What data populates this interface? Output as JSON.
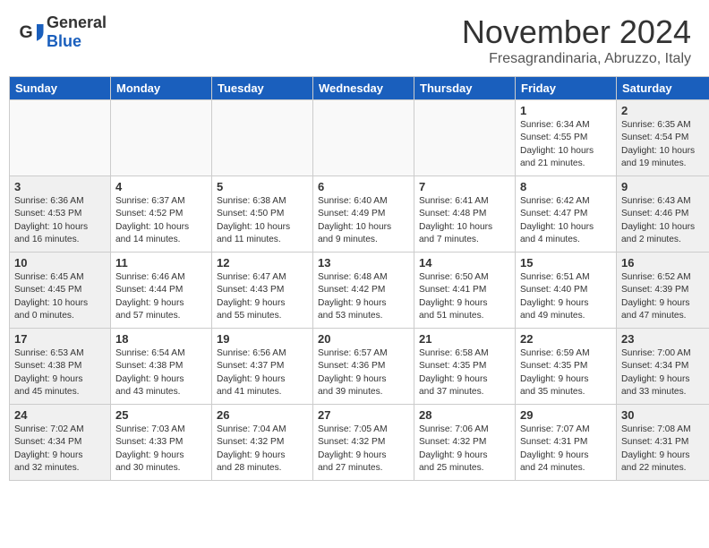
{
  "logo": {
    "general": "General",
    "blue": "Blue"
  },
  "title": "November 2024",
  "location": "Fresagrandinaria, Abruzzo, Italy",
  "days": [
    "Sunday",
    "Monday",
    "Tuesday",
    "Wednesday",
    "Thursday",
    "Friday",
    "Saturday"
  ],
  "weeks": [
    [
      {
        "day": "",
        "info": ""
      },
      {
        "day": "",
        "info": ""
      },
      {
        "day": "",
        "info": ""
      },
      {
        "day": "",
        "info": ""
      },
      {
        "day": "",
        "info": ""
      },
      {
        "day": "1",
        "info": "Sunrise: 6:34 AM\nSunset: 4:55 PM\nDaylight: 10 hours\nand 21 minutes."
      },
      {
        "day": "2",
        "info": "Sunrise: 6:35 AM\nSunset: 4:54 PM\nDaylight: 10 hours\nand 19 minutes."
      }
    ],
    [
      {
        "day": "3",
        "info": "Sunrise: 6:36 AM\nSunset: 4:53 PM\nDaylight: 10 hours\nand 16 minutes."
      },
      {
        "day": "4",
        "info": "Sunrise: 6:37 AM\nSunset: 4:52 PM\nDaylight: 10 hours\nand 14 minutes."
      },
      {
        "day": "5",
        "info": "Sunrise: 6:38 AM\nSunset: 4:50 PM\nDaylight: 10 hours\nand 11 minutes."
      },
      {
        "day": "6",
        "info": "Sunrise: 6:40 AM\nSunset: 4:49 PM\nDaylight: 10 hours\nand 9 minutes."
      },
      {
        "day": "7",
        "info": "Sunrise: 6:41 AM\nSunset: 4:48 PM\nDaylight: 10 hours\nand 7 minutes."
      },
      {
        "day": "8",
        "info": "Sunrise: 6:42 AM\nSunset: 4:47 PM\nDaylight: 10 hours\nand 4 minutes."
      },
      {
        "day": "9",
        "info": "Sunrise: 6:43 AM\nSunset: 4:46 PM\nDaylight: 10 hours\nand 2 minutes."
      }
    ],
    [
      {
        "day": "10",
        "info": "Sunrise: 6:45 AM\nSunset: 4:45 PM\nDaylight: 10 hours\nand 0 minutes."
      },
      {
        "day": "11",
        "info": "Sunrise: 6:46 AM\nSunset: 4:44 PM\nDaylight: 9 hours\nand 57 minutes."
      },
      {
        "day": "12",
        "info": "Sunrise: 6:47 AM\nSunset: 4:43 PM\nDaylight: 9 hours\nand 55 minutes."
      },
      {
        "day": "13",
        "info": "Sunrise: 6:48 AM\nSunset: 4:42 PM\nDaylight: 9 hours\nand 53 minutes."
      },
      {
        "day": "14",
        "info": "Sunrise: 6:50 AM\nSunset: 4:41 PM\nDaylight: 9 hours\nand 51 minutes."
      },
      {
        "day": "15",
        "info": "Sunrise: 6:51 AM\nSunset: 4:40 PM\nDaylight: 9 hours\nand 49 minutes."
      },
      {
        "day": "16",
        "info": "Sunrise: 6:52 AM\nSunset: 4:39 PM\nDaylight: 9 hours\nand 47 minutes."
      }
    ],
    [
      {
        "day": "17",
        "info": "Sunrise: 6:53 AM\nSunset: 4:38 PM\nDaylight: 9 hours\nand 45 minutes."
      },
      {
        "day": "18",
        "info": "Sunrise: 6:54 AM\nSunset: 4:38 PM\nDaylight: 9 hours\nand 43 minutes."
      },
      {
        "day": "19",
        "info": "Sunrise: 6:56 AM\nSunset: 4:37 PM\nDaylight: 9 hours\nand 41 minutes."
      },
      {
        "day": "20",
        "info": "Sunrise: 6:57 AM\nSunset: 4:36 PM\nDaylight: 9 hours\nand 39 minutes."
      },
      {
        "day": "21",
        "info": "Sunrise: 6:58 AM\nSunset: 4:35 PM\nDaylight: 9 hours\nand 37 minutes."
      },
      {
        "day": "22",
        "info": "Sunrise: 6:59 AM\nSunset: 4:35 PM\nDaylight: 9 hours\nand 35 minutes."
      },
      {
        "day": "23",
        "info": "Sunrise: 7:00 AM\nSunset: 4:34 PM\nDaylight: 9 hours\nand 33 minutes."
      }
    ],
    [
      {
        "day": "24",
        "info": "Sunrise: 7:02 AM\nSunset: 4:34 PM\nDaylight: 9 hours\nand 32 minutes."
      },
      {
        "day": "25",
        "info": "Sunrise: 7:03 AM\nSunset: 4:33 PM\nDaylight: 9 hours\nand 30 minutes."
      },
      {
        "day": "26",
        "info": "Sunrise: 7:04 AM\nSunset: 4:32 PM\nDaylight: 9 hours\nand 28 minutes."
      },
      {
        "day": "27",
        "info": "Sunrise: 7:05 AM\nSunset: 4:32 PM\nDaylight: 9 hours\nand 27 minutes."
      },
      {
        "day": "28",
        "info": "Sunrise: 7:06 AM\nSunset: 4:32 PM\nDaylight: 9 hours\nand 25 minutes."
      },
      {
        "day": "29",
        "info": "Sunrise: 7:07 AM\nSunset: 4:31 PM\nDaylight: 9 hours\nand 24 minutes."
      },
      {
        "day": "30",
        "info": "Sunrise: 7:08 AM\nSunset: 4:31 PM\nDaylight: 9 hours\nand 22 minutes."
      }
    ]
  ]
}
